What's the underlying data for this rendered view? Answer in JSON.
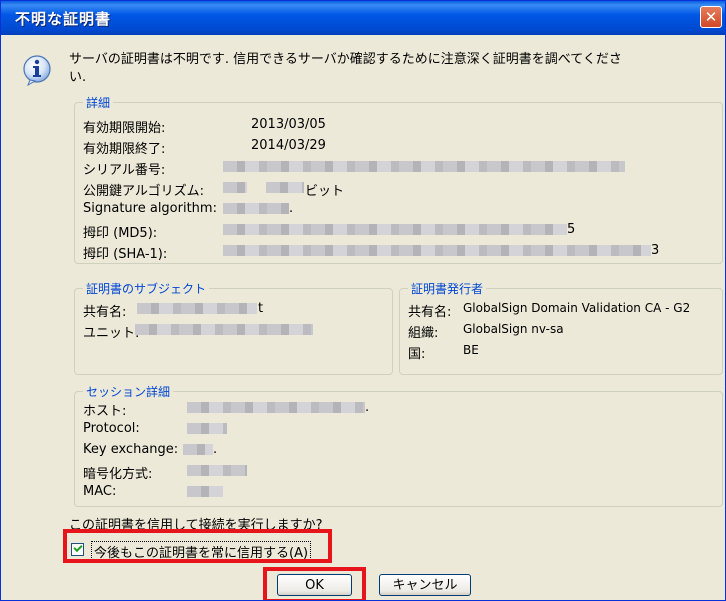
{
  "window": {
    "title": "不明な証明書",
    "close_glyph": "✕"
  },
  "message": "サーバの証明書は不明です. 信用できるサーバか確認するために注意深く証明書を調べてください.",
  "details": {
    "title": "詳細",
    "rows": [
      {
        "label": "有効期限開始:",
        "value": "2013/03/05"
      },
      {
        "label": "有効期限終了:",
        "value": "2014/03/29"
      },
      {
        "label": "シリアル番号:",
        "value": ""
      },
      {
        "label": "公開鍵アルゴリズム:",
        "value": "ビット"
      },
      {
        "label": "Signature algorithm:",
        "value": "."
      },
      {
        "label": "拇印 (MD5):",
        "value": "5"
      },
      {
        "label": "拇印 (SHA-1):",
        "value": "3"
      }
    ]
  },
  "subject": {
    "title": "証明書のサブジェクト",
    "rows": [
      {
        "label": "共有名:",
        "value": "t"
      },
      {
        "label": "ユニット:",
        "value": ""
      }
    ]
  },
  "issuer": {
    "title": "証明書発行者",
    "rows": [
      {
        "label": "共有名:",
        "value": "GlobalSign Domain Validation CA - G2"
      },
      {
        "label": "組織:",
        "value": "GlobalSign nv-sa"
      },
      {
        "label": "国:",
        "value": "BE"
      }
    ]
  },
  "session": {
    "title": "セッション詳細",
    "rows": [
      {
        "label": "ホスト:",
        "value": "."
      },
      {
        "label": "Protocol:",
        "value": ""
      },
      {
        "label": "Key exchange:",
        "value": "."
      },
      {
        "label": "暗号化方式:",
        "value": ""
      },
      {
        "label": "MAC:",
        "value": ""
      }
    ]
  },
  "question": "この証明書を信用して接続を実行しますか?",
  "always_trust": {
    "label": "今後もこの証明書を常に信用する(A)",
    "checked": true
  },
  "buttons": {
    "ok": "OK",
    "cancel": "キャンセル"
  },
  "colors": {
    "title_bar": "#0058e6",
    "group_title": "#0046d5",
    "highlight": "#e8141b"
  }
}
